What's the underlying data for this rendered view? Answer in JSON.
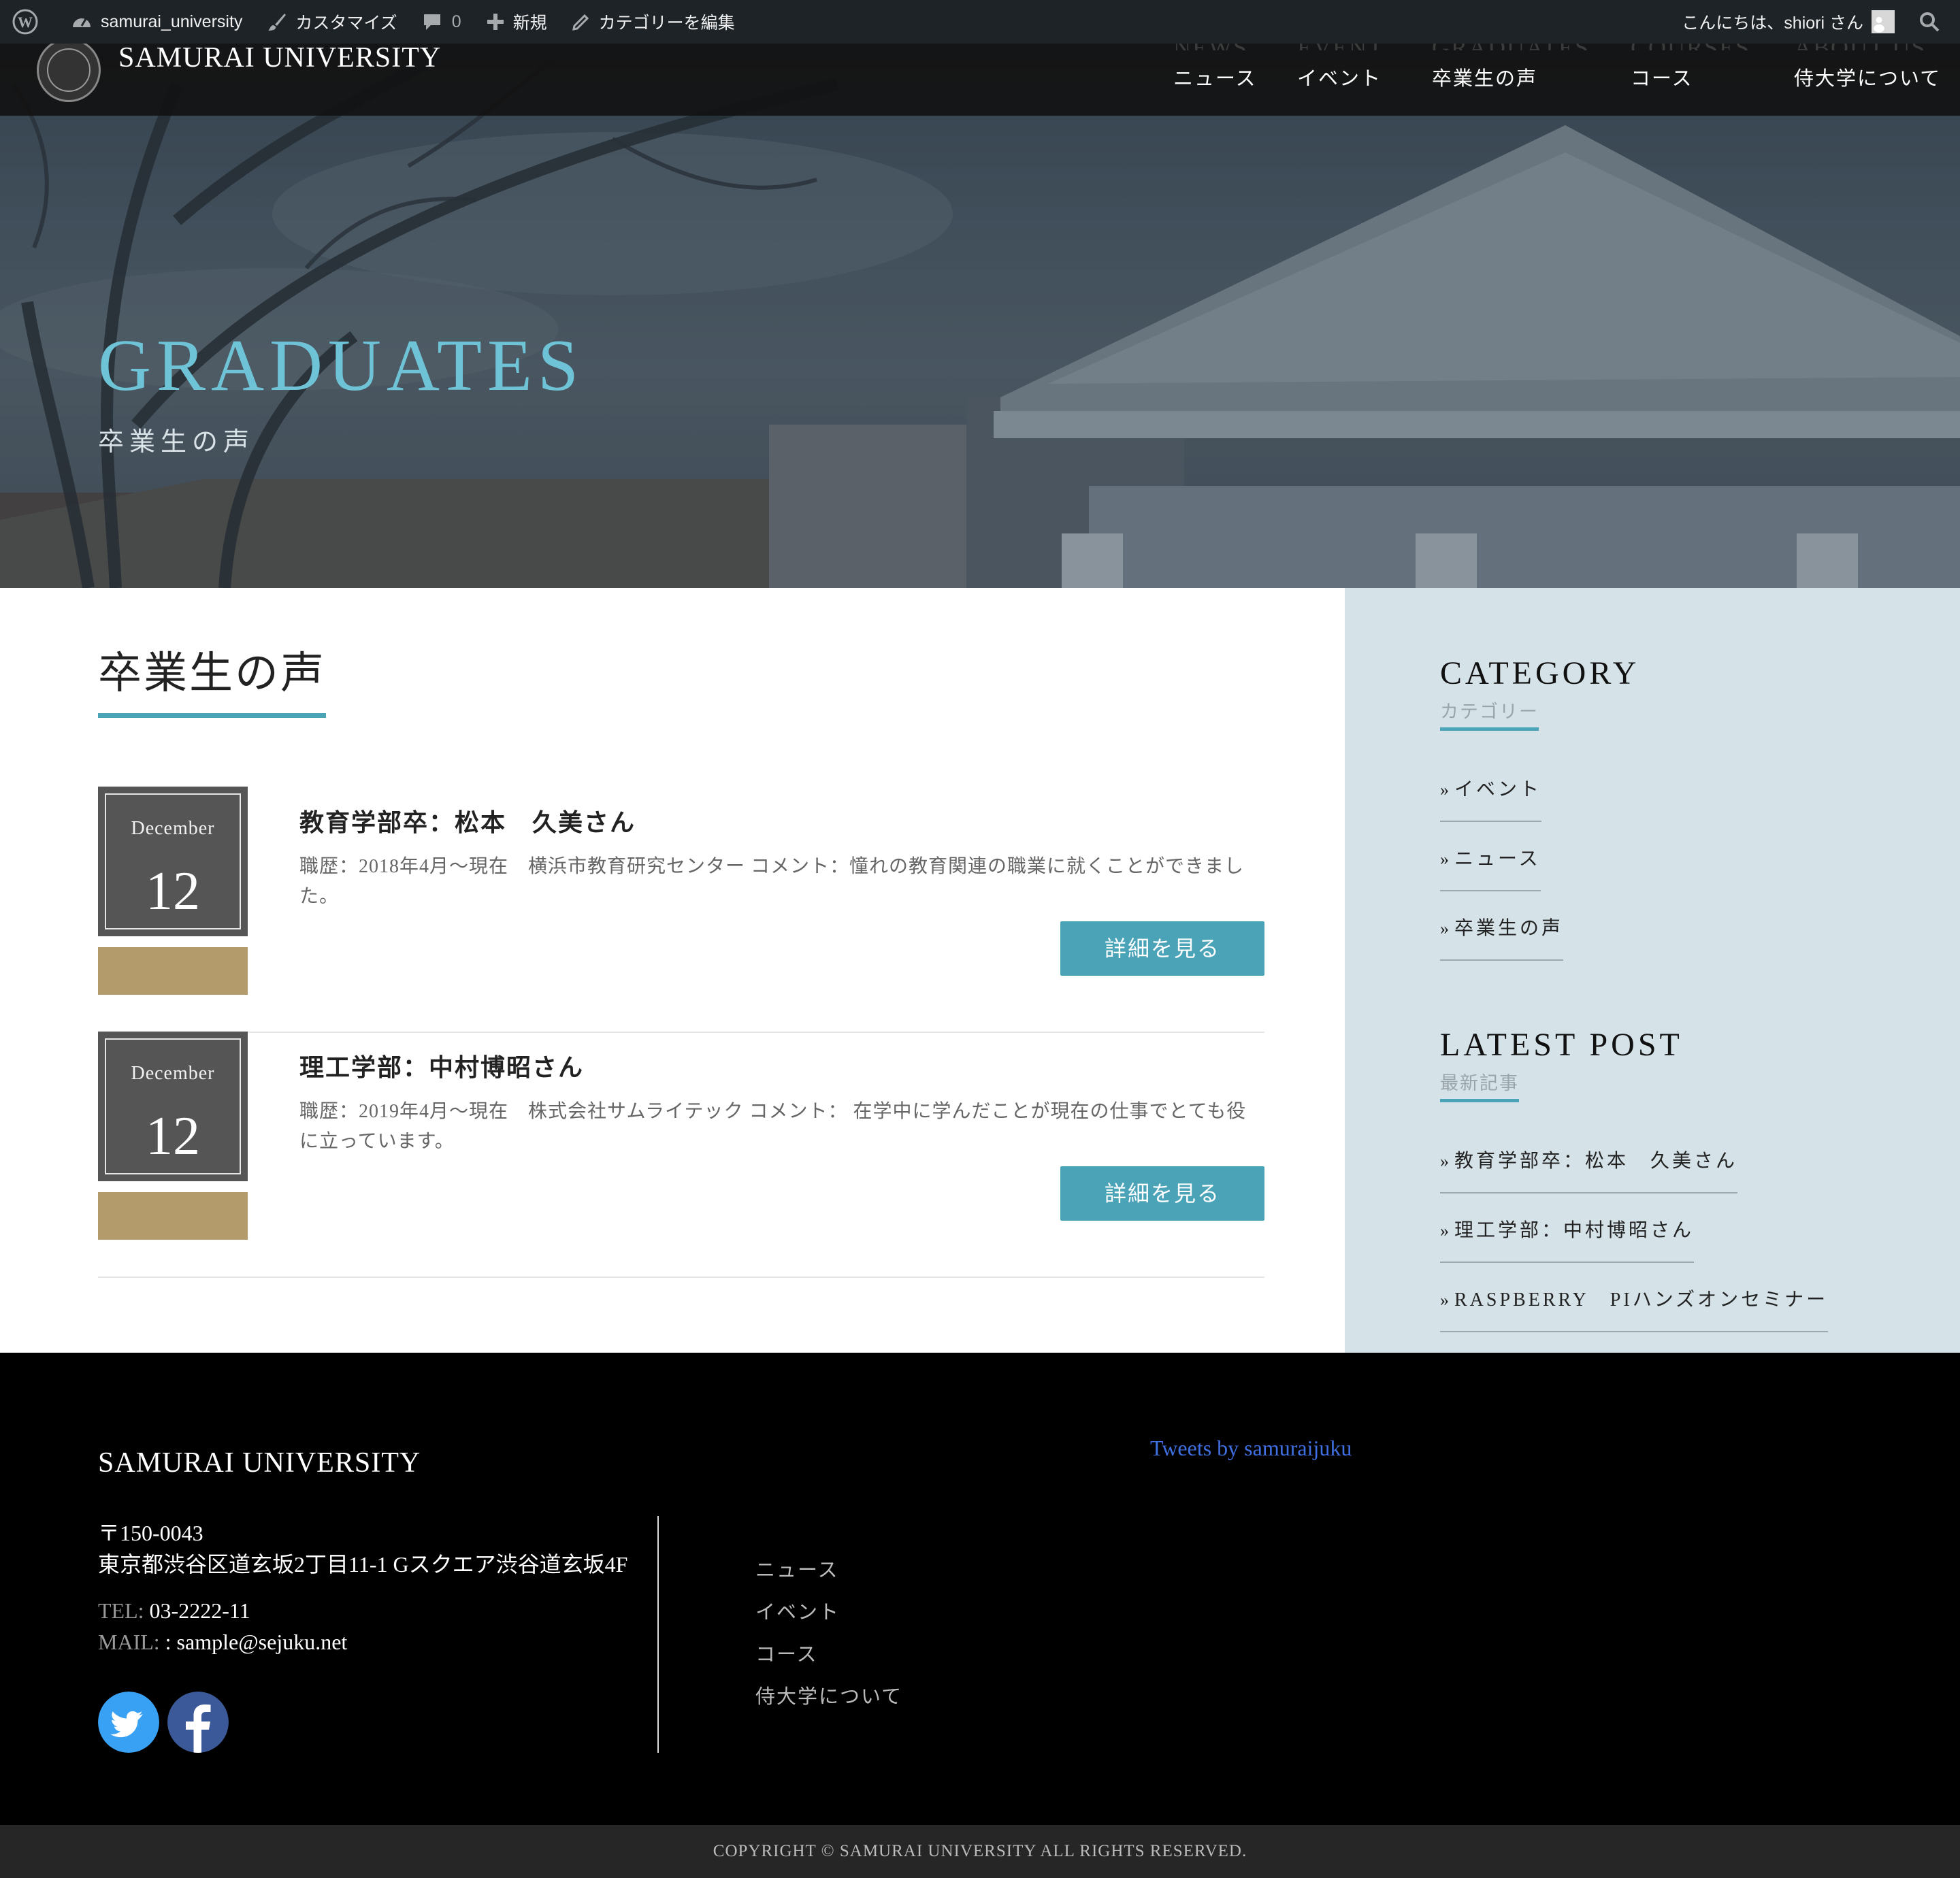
{
  "admin_bar": {
    "site_name": "samurai_university",
    "customize": "カスタマイズ",
    "comments_count": "0",
    "new": "新規",
    "edit_category": "カテゴリーを編集",
    "greeting": "こんにちは、shiori さん"
  },
  "header": {
    "site_title": "SAMURAI UNIVERSITY",
    "nav": [
      {
        "en": "NEWS",
        "ja": "ニュース"
      },
      {
        "en": "EVENT",
        "ja": "イベント"
      },
      {
        "en": "GRADUATES",
        "ja": "卒業生の声"
      },
      {
        "en": "COURSES",
        "ja": "コース"
      },
      {
        "en": "ABOUT US",
        "ja": "侍大学について"
      }
    ]
  },
  "hero": {
    "title": "GRADUATES",
    "subtitle": "卒業生の声"
  },
  "main": {
    "heading": "卒業生の声",
    "posts": [
      {
        "month": "December",
        "day": "12",
        "title": "教育学部卒：松本　久美さん",
        "excerpt": "職歴：2018年4月～現在　横浜市教育研究センター コメント：憧れの教育関連の職業に就くことができました。",
        "button": "詳細を見る"
      },
      {
        "month": "December",
        "day": "12",
        "title": "理工学部：中村博昭さん",
        "excerpt": "職歴：2019年4月～現在　株式会社サムライテック コメント： 在学中に学んだことが現在の仕事でとても役に立っています。",
        "button": "詳細を見る"
      }
    ]
  },
  "sidebar": {
    "category": {
      "title": "CATEGORY",
      "subtitle": "カテゴリー",
      "items": [
        "イベント",
        "ニュース",
        "卒業生の声"
      ]
    },
    "latest": {
      "title": "LATEST POST",
      "subtitle": "最新記事",
      "items": [
        "教育学部卒：松本　久美さん",
        "理工学部：中村博昭さん",
        "RASPBERRY　PIハンズオンセミナー"
      ]
    }
  },
  "footer": {
    "title": "SAMURAI UNIVERSITY",
    "postal": "〒150-0043",
    "address": "東京都渋谷区道玄坂2丁目11-1 Gスクエア渋谷道玄坂4F",
    "tel_label": "TEL:",
    "tel": "03-2222-11",
    "mail_label": "MAIL:",
    "mail": ": sample@sejuku.net",
    "nav": [
      "ニュース",
      "イベント",
      "コース",
      "侍大学について"
    ],
    "tweets_link": "Tweets by samuraijuku"
  },
  "copyright": "COPYRIGHT © SAMURAI UNIVERSITY ALL RIGHTS RESERVED.",
  "colors": {
    "accent": "#4ba3b8",
    "hero_title": "#6fc3d6",
    "category_bar": "#b39b6c",
    "sidebar_bg": "#d5e3e8",
    "twitter": "#38a1f3",
    "facebook": "#3b5998"
  }
}
